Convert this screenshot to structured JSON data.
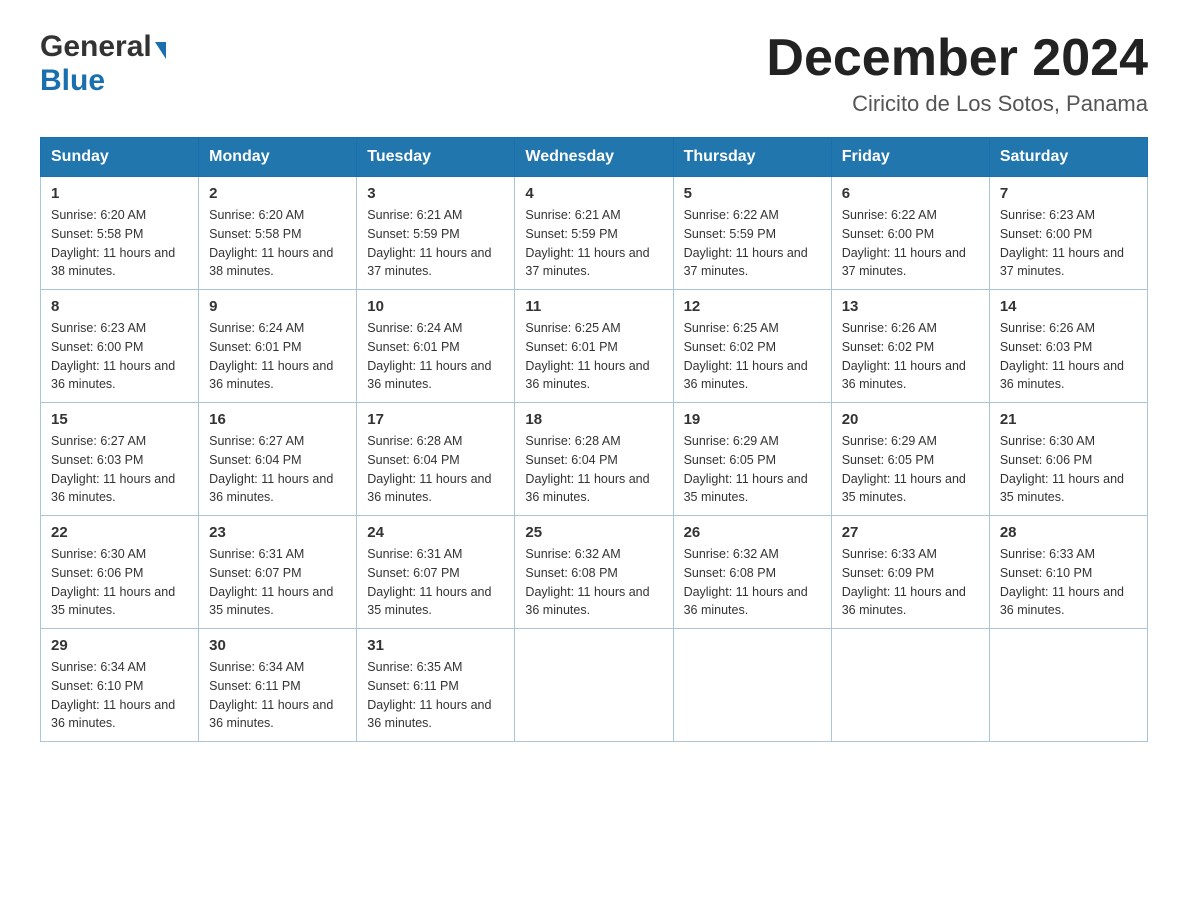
{
  "header": {
    "logo_general": "General",
    "logo_blue": "Blue",
    "month_title": "December 2024",
    "location": "Ciricito de Los Sotos, Panama"
  },
  "days_of_week": [
    "Sunday",
    "Monday",
    "Tuesday",
    "Wednesday",
    "Thursday",
    "Friday",
    "Saturday"
  ],
  "weeks": [
    [
      {
        "day": "1",
        "sunrise": "6:20 AM",
        "sunset": "5:58 PM",
        "daylight": "11 hours and 38 minutes."
      },
      {
        "day": "2",
        "sunrise": "6:20 AM",
        "sunset": "5:58 PM",
        "daylight": "11 hours and 38 minutes."
      },
      {
        "day": "3",
        "sunrise": "6:21 AM",
        "sunset": "5:59 PM",
        "daylight": "11 hours and 37 minutes."
      },
      {
        "day": "4",
        "sunrise": "6:21 AM",
        "sunset": "5:59 PM",
        "daylight": "11 hours and 37 minutes."
      },
      {
        "day": "5",
        "sunrise": "6:22 AM",
        "sunset": "5:59 PM",
        "daylight": "11 hours and 37 minutes."
      },
      {
        "day": "6",
        "sunrise": "6:22 AM",
        "sunset": "6:00 PM",
        "daylight": "11 hours and 37 minutes."
      },
      {
        "day": "7",
        "sunrise": "6:23 AM",
        "sunset": "6:00 PM",
        "daylight": "11 hours and 37 minutes."
      }
    ],
    [
      {
        "day": "8",
        "sunrise": "6:23 AM",
        "sunset": "6:00 PM",
        "daylight": "11 hours and 36 minutes."
      },
      {
        "day": "9",
        "sunrise": "6:24 AM",
        "sunset": "6:01 PM",
        "daylight": "11 hours and 36 minutes."
      },
      {
        "day": "10",
        "sunrise": "6:24 AM",
        "sunset": "6:01 PM",
        "daylight": "11 hours and 36 minutes."
      },
      {
        "day": "11",
        "sunrise": "6:25 AM",
        "sunset": "6:01 PM",
        "daylight": "11 hours and 36 minutes."
      },
      {
        "day": "12",
        "sunrise": "6:25 AM",
        "sunset": "6:02 PM",
        "daylight": "11 hours and 36 minutes."
      },
      {
        "day": "13",
        "sunrise": "6:26 AM",
        "sunset": "6:02 PM",
        "daylight": "11 hours and 36 minutes."
      },
      {
        "day": "14",
        "sunrise": "6:26 AM",
        "sunset": "6:03 PM",
        "daylight": "11 hours and 36 minutes."
      }
    ],
    [
      {
        "day": "15",
        "sunrise": "6:27 AM",
        "sunset": "6:03 PM",
        "daylight": "11 hours and 36 minutes."
      },
      {
        "day": "16",
        "sunrise": "6:27 AM",
        "sunset": "6:04 PM",
        "daylight": "11 hours and 36 minutes."
      },
      {
        "day": "17",
        "sunrise": "6:28 AM",
        "sunset": "6:04 PM",
        "daylight": "11 hours and 36 minutes."
      },
      {
        "day": "18",
        "sunrise": "6:28 AM",
        "sunset": "6:04 PM",
        "daylight": "11 hours and 36 minutes."
      },
      {
        "day": "19",
        "sunrise": "6:29 AM",
        "sunset": "6:05 PM",
        "daylight": "11 hours and 35 minutes."
      },
      {
        "day": "20",
        "sunrise": "6:29 AM",
        "sunset": "6:05 PM",
        "daylight": "11 hours and 35 minutes."
      },
      {
        "day": "21",
        "sunrise": "6:30 AM",
        "sunset": "6:06 PM",
        "daylight": "11 hours and 35 minutes."
      }
    ],
    [
      {
        "day": "22",
        "sunrise": "6:30 AM",
        "sunset": "6:06 PM",
        "daylight": "11 hours and 35 minutes."
      },
      {
        "day": "23",
        "sunrise": "6:31 AM",
        "sunset": "6:07 PM",
        "daylight": "11 hours and 35 minutes."
      },
      {
        "day": "24",
        "sunrise": "6:31 AM",
        "sunset": "6:07 PM",
        "daylight": "11 hours and 35 minutes."
      },
      {
        "day": "25",
        "sunrise": "6:32 AM",
        "sunset": "6:08 PM",
        "daylight": "11 hours and 36 minutes."
      },
      {
        "day": "26",
        "sunrise": "6:32 AM",
        "sunset": "6:08 PM",
        "daylight": "11 hours and 36 minutes."
      },
      {
        "day": "27",
        "sunrise": "6:33 AM",
        "sunset": "6:09 PM",
        "daylight": "11 hours and 36 minutes."
      },
      {
        "day": "28",
        "sunrise": "6:33 AM",
        "sunset": "6:10 PM",
        "daylight": "11 hours and 36 minutes."
      }
    ],
    [
      {
        "day": "29",
        "sunrise": "6:34 AM",
        "sunset": "6:10 PM",
        "daylight": "11 hours and 36 minutes."
      },
      {
        "day": "30",
        "sunrise": "6:34 AM",
        "sunset": "6:11 PM",
        "daylight": "11 hours and 36 minutes."
      },
      {
        "day": "31",
        "sunrise": "6:35 AM",
        "sunset": "6:11 PM",
        "daylight": "11 hours and 36 minutes."
      },
      null,
      null,
      null,
      null
    ]
  ],
  "labels": {
    "sunrise": "Sunrise:",
    "sunset": "Sunset:",
    "daylight": "Daylight:"
  }
}
